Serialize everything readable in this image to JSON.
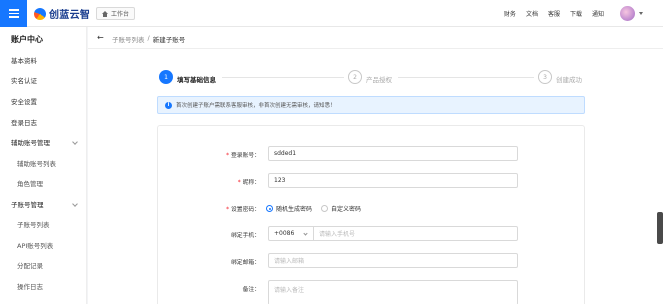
{
  "header": {
    "logo_text": "创蓝云智",
    "workbench_label": "工作台",
    "nav": [
      "财务",
      "文档",
      "客服",
      "下载",
      "通知"
    ]
  },
  "sidebar": {
    "title": "账户中心",
    "items": [
      {
        "label": "基本资料"
      },
      {
        "label": "实名认证"
      },
      {
        "label": "安全设置"
      },
      {
        "label": "登录日志"
      },
      {
        "label": "辅助账号管理"
      },
      {
        "label": "辅助账号列表"
      },
      {
        "label": "角色管理"
      },
      {
        "label": "子账号管理"
      },
      {
        "label": "子账号列表"
      },
      {
        "label": "API账号列表"
      },
      {
        "label": "分配记录"
      },
      {
        "label": "操作日志"
      }
    ]
  },
  "breadcrumb": {
    "back": "←",
    "parent": "子账号列表",
    "sep": "/",
    "current": "新建子账号"
  },
  "steps": [
    {
      "num": "1",
      "label": "填写基础信息"
    },
    {
      "num": "2",
      "label": "产品授权"
    },
    {
      "num": "3",
      "label": "创建成功"
    }
  ],
  "notice": {
    "icon": "i",
    "text": "首次创建子账户需联系客服审核，非首次创建无需审核，请知悉！"
  },
  "form": {
    "account": {
      "label": "登录账号：",
      "value": "sdded1"
    },
    "nickname": {
      "label": "昵称：",
      "value": "123"
    },
    "password": {
      "label": "设置密码：",
      "options": [
        "随机生成密码",
        "自定义密码"
      ]
    },
    "phone": {
      "label": "绑定手机：",
      "country_code": "+0086",
      "placeholder": "请输入手机号"
    },
    "email": {
      "label": "绑定邮箱：",
      "placeholder": "请输入邮箱"
    },
    "remark": {
      "label": "备注：",
      "placeholder": "请输入备注"
    }
  },
  "colors": {
    "accent": "#1677ff",
    "required": "#f5222d"
  }
}
